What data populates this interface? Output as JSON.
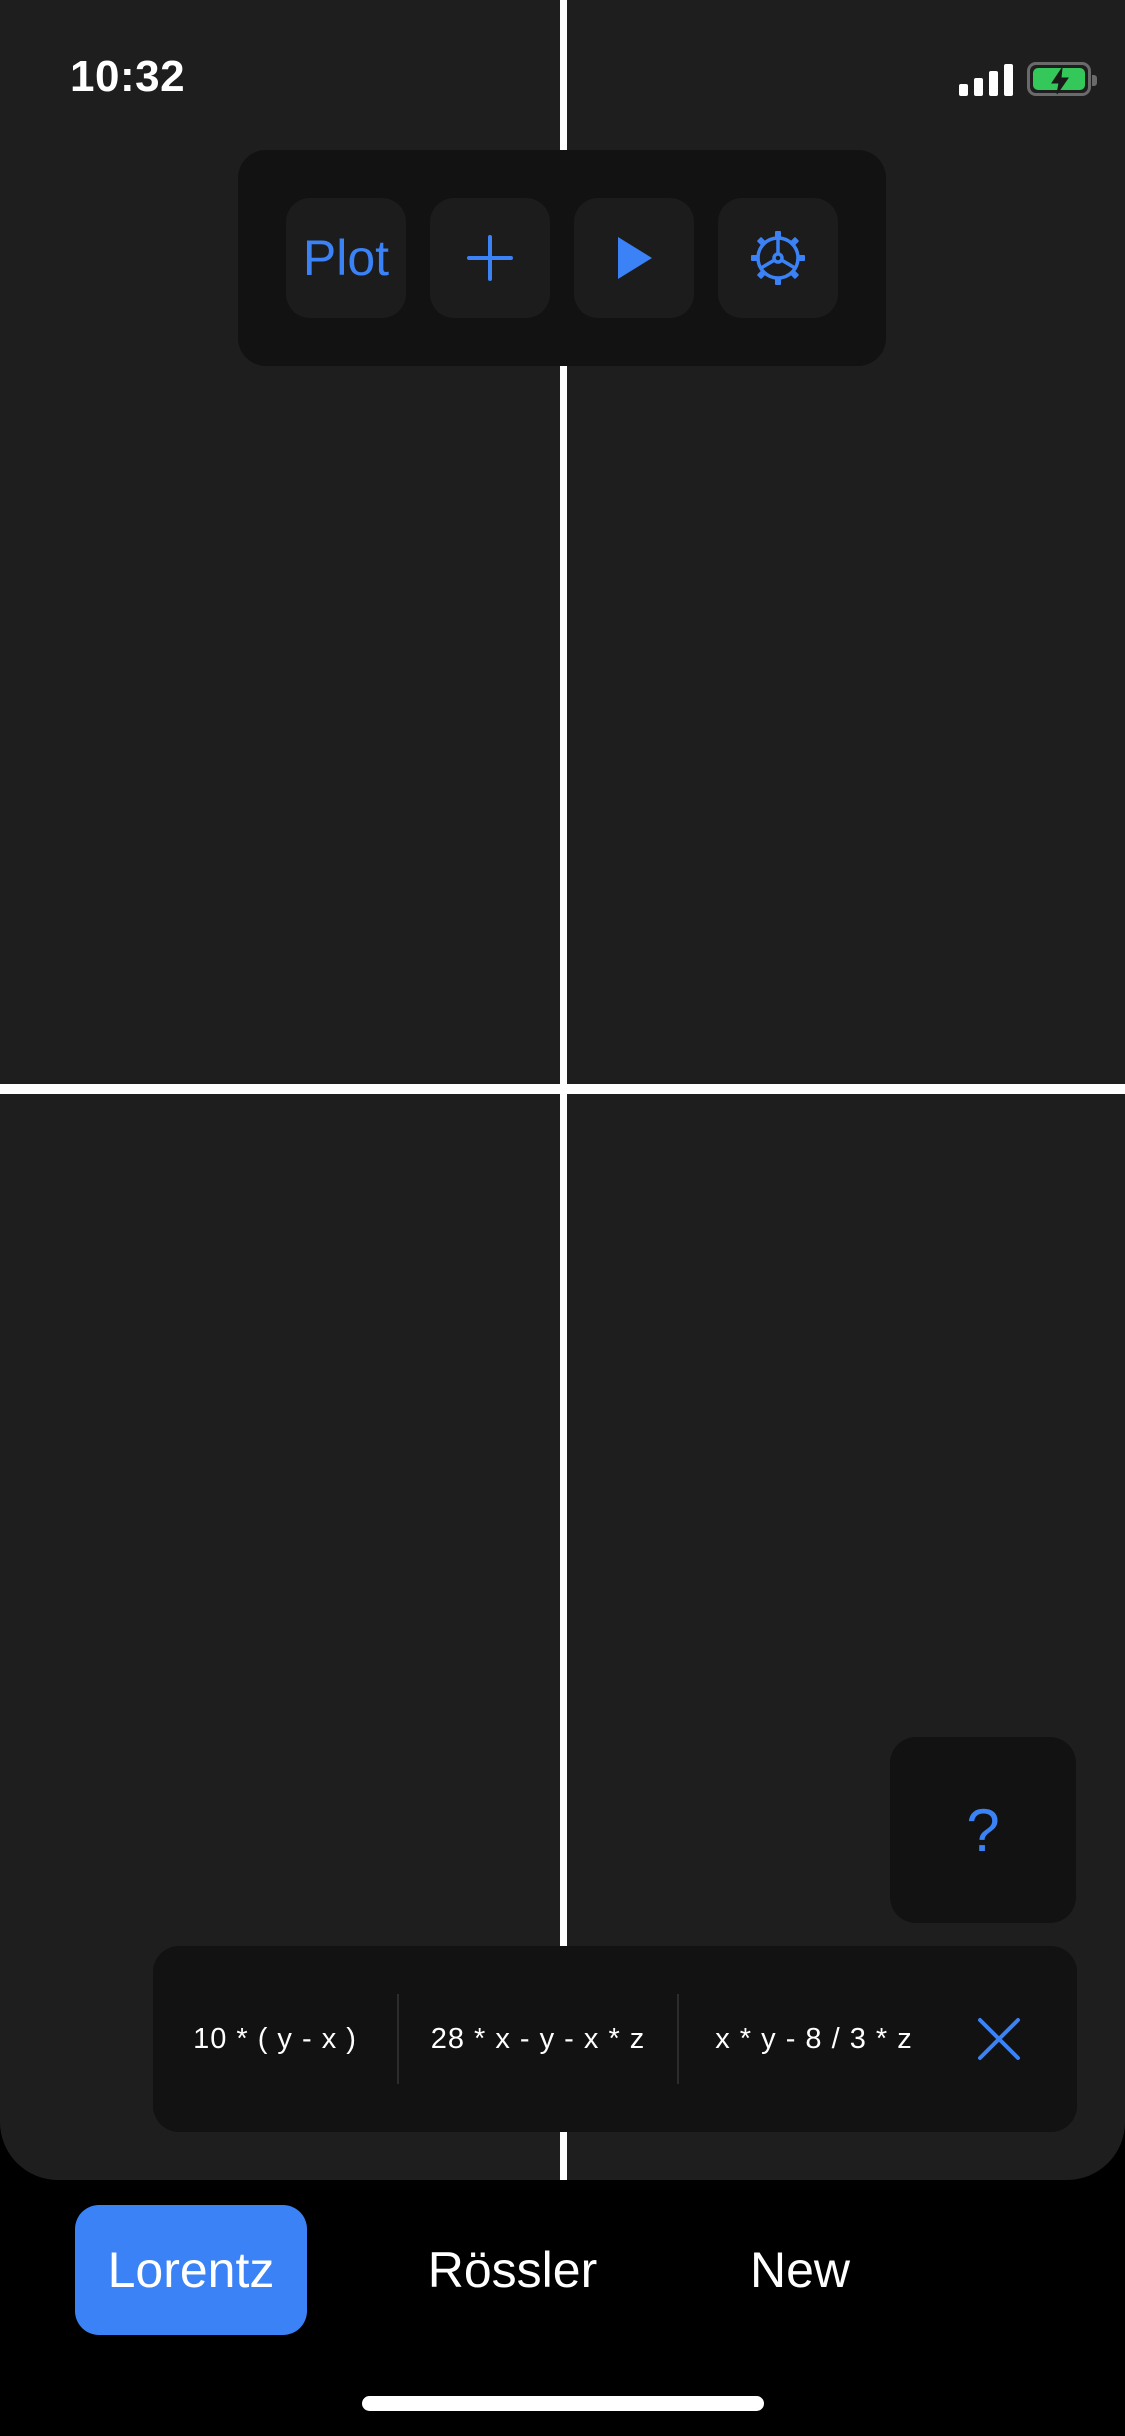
{
  "status_bar": {
    "time": "10:32",
    "battery_state": "charging",
    "battery_color": "#34c759"
  },
  "toolbar": {
    "plot_label": "Plot",
    "add_icon": "plus-icon",
    "play_icon": "play-icon",
    "settings_icon": "gear-icon"
  },
  "help": {
    "label": "?"
  },
  "equations": {
    "dx": "10 * ( y - x )",
    "dy": "28 * x - y - x * z",
    "dz": "x * y - 8 / 3 * z",
    "close_icon": "close-icon"
  },
  "tabs": [
    {
      "label": "Lorentz",
      "active": true
    },
    {
      "label": "Rössler",
      "active": false
    },
    {
      "label": "New",
      "active": false
    }
  ],
  "colors": {
    "accent": "#3a82f6",
    "canvas_background": "#1e1e1e",
    "panel_background": "#121212",
    "axis": "#ffffff"
  }
}
